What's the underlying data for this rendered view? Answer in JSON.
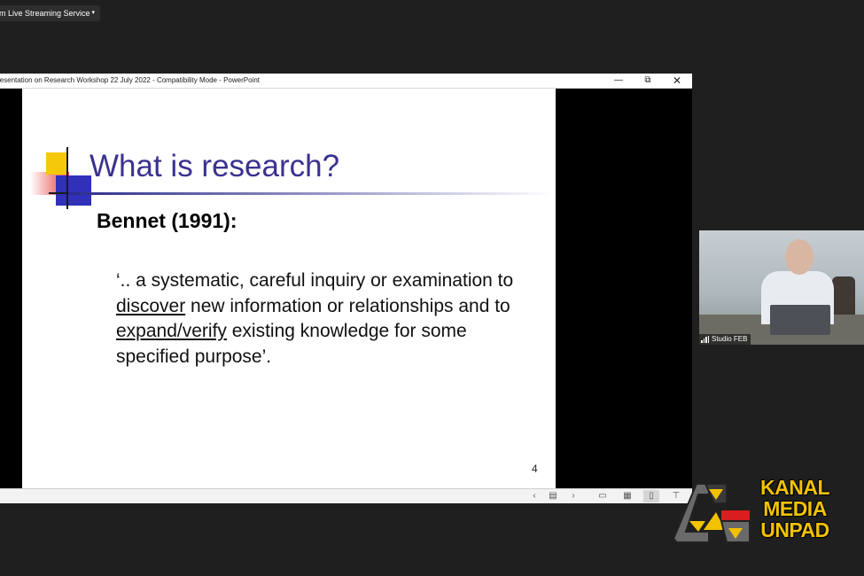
{
  "zoom_bar": {
    "label": "om Live Streaming Service",
    "caret": "▾"
  },
  "window": {
    "title": "resentation on Research Workshop 22 July 2022  -  Compatibility Mode - PowerPoint",
    "controls": {
      "minimize": "—",
      "maximize": "⧉",
      "close": "✕"
    }
  },
  "slide": {
    "title": "What is research?",
    "subheading": "Bennet (1991):",
    "quote": {
      "part1": "‘.. a systematic, careful inquiry or examination to ",
      "link1": "discover",
      "part2": " new information or relationships and to ",
      "link2": "expand/verify",
      "part3": " existing knowledge for some specified purpose’."
    },
    "page_number": "4",
    "colors": {
      "title": "#3a3290",
      "deco_yellow": "#f5c90a",
      "deco_blue": "#3030b8",
      "deco_red": "#e85b5b"
    }
  },
  "statusbar": {
    "prev": "‹",
    "notes": "▤",
    "next": "›",
    "view_normal": "▭",
    "view_sorter": "▦",
    "view_reading": "▯",
    "view_slideshow": "⊤"
  },
  "video_tile": {
    "name": "Studio FEB"
  },
  "watermark": {
    "line1": "KANAL",
    "line2": "MEDIA",
    "line3": "UNPAD",
    "color": "#f2c200"
  }
}
